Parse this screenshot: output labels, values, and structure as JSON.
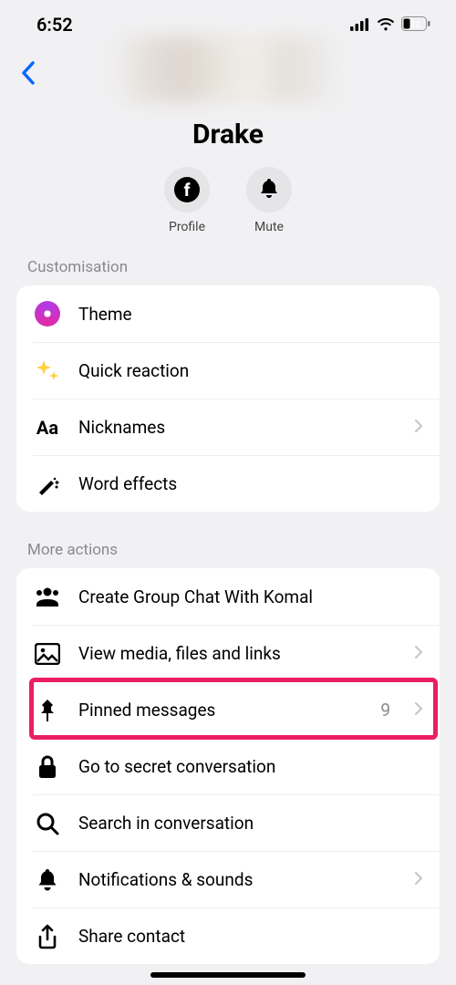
{
  "status": {
    "time": "6:52",
    "battery": "22"
  },
  "header": {
    "title": "Drake",
    "actions": {
      "profile": "Profile",
      "mute": "Mute"
    }
  },
  "sections": {
    "customisation": {
      "heading": "Customisation",
      "items": {
        "theme": "Theme",
        "quick_reaction": "Quick reaction",
        "nicknames": "Nicknames",
        "word_effects": "Word effects"
      }
    },
    "more_actions": {
      "heading": "More actions",
      "items": {
        "create_group": "Create Group Chat With Komal",
        "view_media": "View media, files and links",
        "pinned": "Pinned messages",
        "pinned_count": "9",
        "secret": "Go to secret conversation",
        "search": "Search in conversation",
        "notifications": "Notifications & sounds",
        "share": "Share contact"
      }
    }
  }
}
